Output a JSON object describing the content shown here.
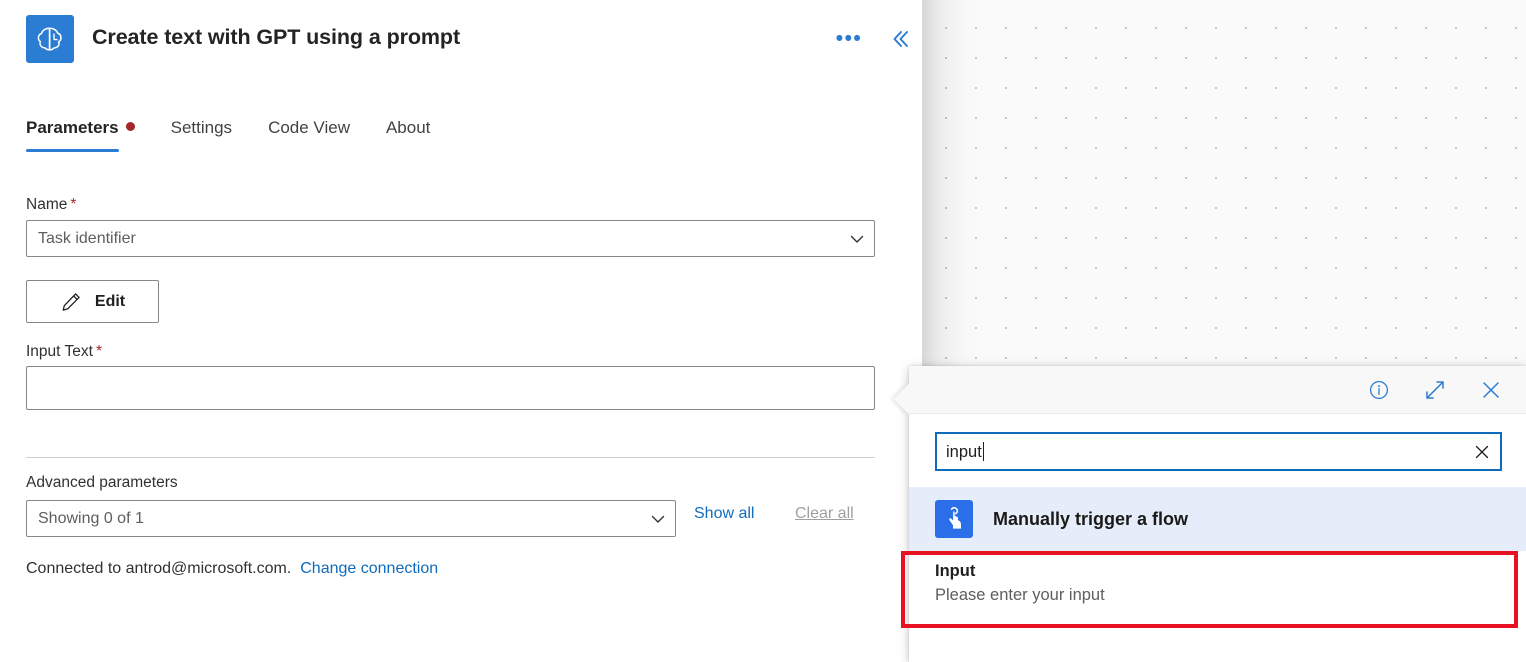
{
  "header": {
    "title": "Create text with GPT using a prompt",
    "app_icon": "gpt-brain-icon",
    "more_label": "•••",
    "collapse_label": "«",
    "accent_color": "#2b7cd3"
  },
  "tabs": [
    {
      "label": "Parameters",
      "active": true,
      "has_dot": true,
      "dot_color": "#a4262c"
    },
    {
      "label": "Settings",
      "active": false,
      "has_dot": false
    },
    {
      "label": "Code View",
      "active": false,
      "has_dot": false
    },
    {
      "label": "About",
      "active": false,
      "has_dot": false
    }
  ],
  "form": {
    "name": {
      "label": "Name",
      "required_marker": "*",
      "value": "Task identifier",
      "chevron": "chevron-down"
    },
    "edit_button": {
      "label": "Edit",
      "icon": "pencil-icon"
    },
    "input_text": {
      "label": "Input Text",
      "required_marker": "*",
      "value": ""
    },
    "advanced": {
      "label": "Advanced parameters",
      "value": "Showing 0 of 1",
      "show_all": "Show all",
      "clear_all": "Clear all",
      "link_color": "#0f6cbd",
      "disabled_color": "#a19f9d"
    },
    "connection": {
      "text": "Connected to antrod@microsoft.com.",
      "link": "Change connection"
    }
  },
  "flyout": {
    "toolbar": {
      "info_icon": "info-circle-icon",
      "expand_icon": "expand-diagonal-icon",
      "close_icon": "close-x-icon",
      "icon_color": "#2b7cd3"
    },
    "search": {
      "value": "input",
      "placeholder": "Search",
      "clear_icon": "clear-x-icon",
      "border_color": "#0f6cbd"
    },
    "results": [
      {
        "type": "trigger",
        "icon": "manual-trigger-hand-icon",
        "icon_bg": "#2b6fe8",
        "title": "Manually trigger a flow",
        "subtitle": "",
        "highlighted": true
      },
      {
        "type": "parameter",
        "icon": "",
        "title": "Input",
        "subtitle": "Please enter your input",
        "highlighted": false
      }
    ]
  },
  "annotation": {
    "type": "red-rectangle",
    "color": "#e81123",
    "targets": "Input / Please enter your input"
  }
}
